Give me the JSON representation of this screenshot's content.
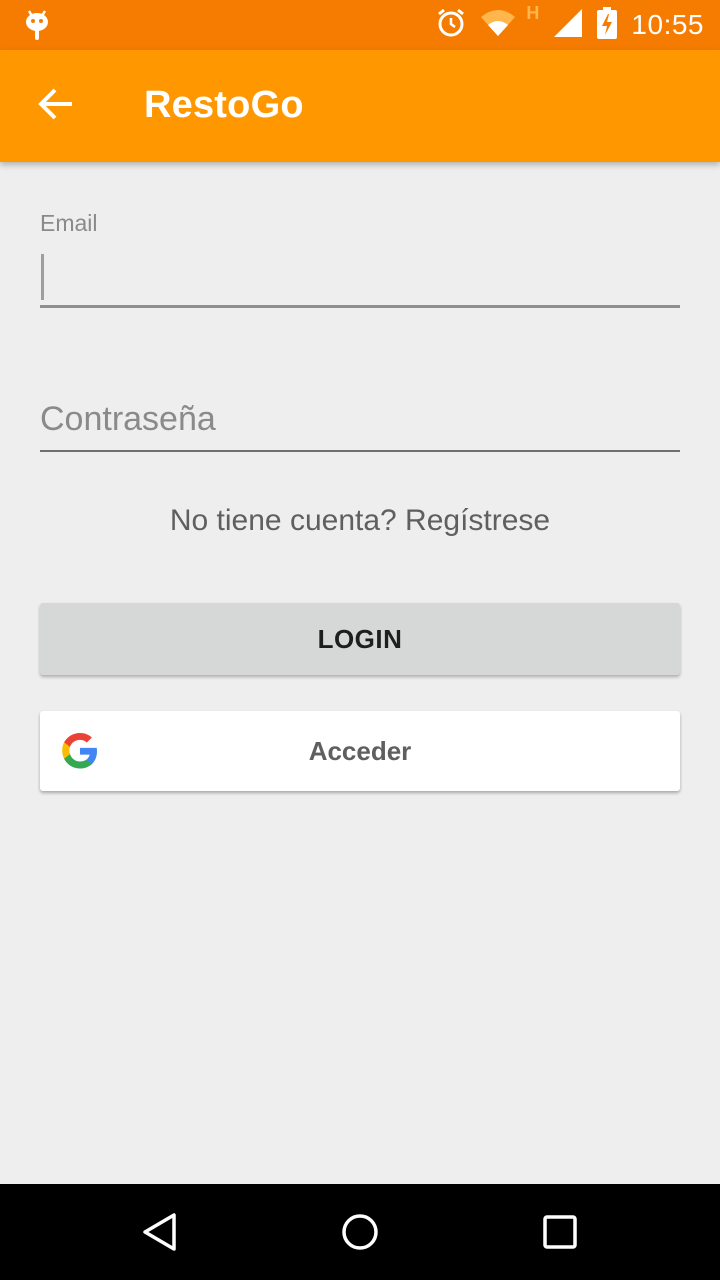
{
  "status_bar": {
    "time": "10:55",
    "network_label": "H",
    "icons": [
      "android-icon",
      "alarm-icon",
      "wifi-icon",
      "signal-icon",
      "battery-charging-icon"
    ]
  },
  "app_bar": {
    "title": "RestoGo",
    "back_icon": "arrow-back-icon",
    "background": "#ff9800",
    "status_color": "#f57c00"
  },
  "form": {
    "email": {
      "label": "Email",
      "value": ""
    },
    "password": {
      "placeholder": "Contraseña",
      "value": ""
    },
    "register_link": "No tiene cuenta? Regístrese",
    "login_button": "LOGIN",
    "google_button": {
      "label": "Acceder",
      "icon": "google-icon"
    }
  },
  "nav_bar": {
    "icons": [
      "back-triangle-icon",
      "home-circle-icon",
      "recents-square-icon"
    ]
  }
}
